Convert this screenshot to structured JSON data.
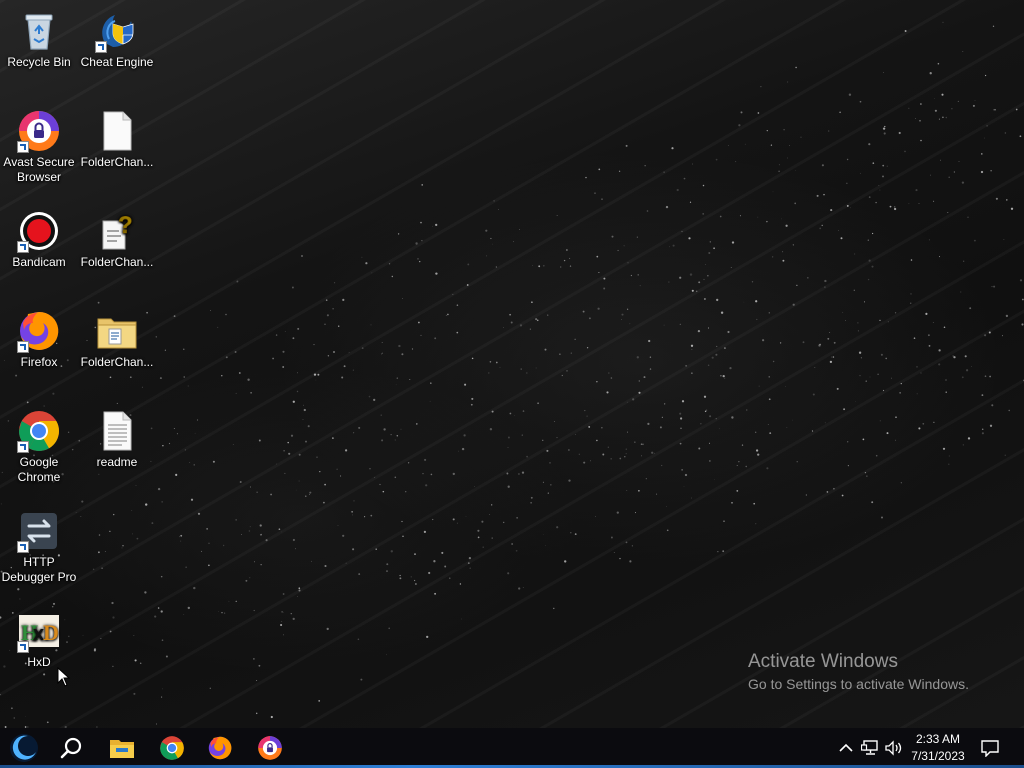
{
  "desktop_icons": [
    {
      "label": "Recycle Bin",
      "icon": "recycle-bin-icon"
    },
    {
      "label": "Cheat Engine",
      "icon": "cheat-engine-icon"
    },
    {
      "label": "Avast Secure Browser",
      "icon": "avast-secure-browser-icon"
    },
    {
      "label": "FolderChan...",
      "icon": "blank-file-icon"
    },
    {
      "label": "Bandicam",
      "icon": "bandicam-icon"
    },
    {
      "label": "FolderChan...",
      "icon": "unknown-file-icon"
    },
    {
      "label": "Firefox",
      "icon": "firefox-icon"
    },
    {
      "label": "FolderChan...",
      "icon": "zip-folder-icon"
    },
    {
      "label": "Google Chrome",
      "icon": "chrome-icon"
    },
    {
      "label": "readme",
      "icon": "text-file-icon"
    },
    {
      "label": "HTTP Debugger Pro",
      "icon": "http-debugger-icon"
    },
    {
      "label": "HxD",
      "icon": "hxd-icon"
    }
  ],
  "activation": {
    "title": "Activate Windows",
    "subtitle": "Go to Settings to activate Windows."
  },
  "taskbar": {
    "pinned": [
      "start-button",
      "search-button",
      "file-explorer",
      "chrome",
      "firefox",
      "avast-secure-browser"
    ],
    "clock": {
      "time": "2:33 AM",
      "date": "7/31/2023"
    },
    "tray": [
      "chevron-up-icon",
      "network-icon",
      "volume-icon",
      "notifications-icon"
    ]
  },
  "colors": {
    "taskbar": "#0b0b0f",
    "accent": "#2e7fd6"
  }
}
